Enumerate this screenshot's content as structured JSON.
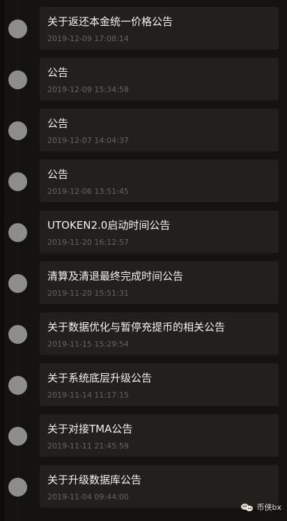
{
  "announcements": [
    {
      "title": "关于返还本金统一价格公告",
      "datetime": "2019-12-09 17:08:14"
    },
    {
      "title": "公告",
      "datetime": "2019-12-09 15:34:58"
    },
    {
      "title": "公告",
      "datetime": "2019-12-07 14:04:37"
    },
    {
      "title": "公告",
      "datetime": "2019-12-06 13:51:45"
    },
    {
      "title": "UTOKEN2.0启动时间公告",
      "datetime": "2019-11-20 16:12:57"
    },
    {
      "title": "清算及清退最终完成时间公告",
      "datetime": "2019-11-20 15:51:31"
    },
    {
      "title": "关于数据优化与暂停充提币的相关公告",
      "datetime": "2019-11-15 15:29:54"
    },
    {
      "title": "关于系统底层升级公告",
      "datetime": "2019-11-14 11:17:15"
    },
    {
      "title": "关于对接TMA公告",
      "datetime": "2019-11-11 21:45:59"
    },
    {
      "title": "关于升级数据库公告",
      "datetime": "2019-11-04 09:44:00"
    }
  ],
  "watermark": {
    "icon": "wechat-icon",
    "label": "币侠bx"
  },
  "colors": {
    "background": "#151312",
    "card": "#22201d",
    "dot": "#8d8d8b",
    "title": "#f3f3f1",
    "time": "#676560"
  }
}
